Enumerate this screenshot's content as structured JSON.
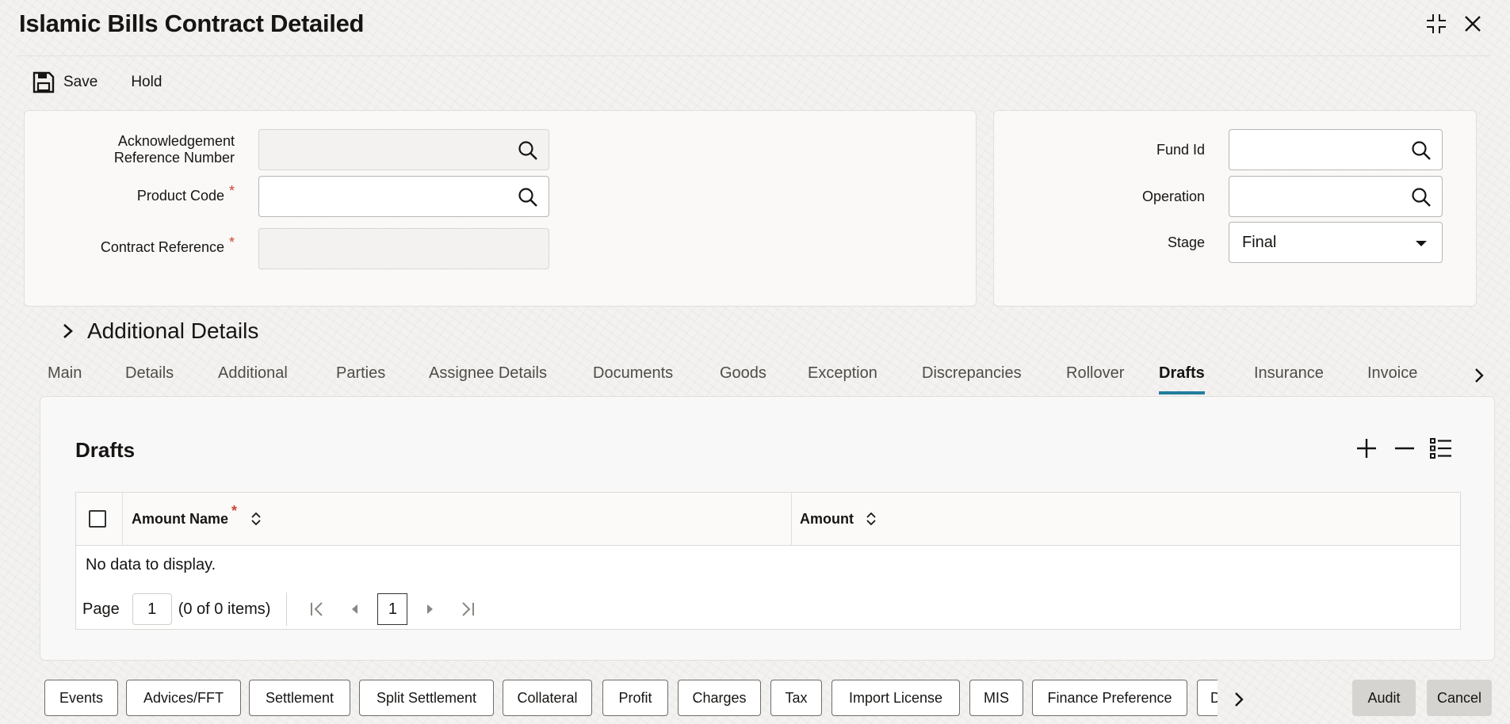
{
  "window": {
    "title": "Islamic Bills Contract Detailed"
  },
  "toolbar": {
    "save_label": "Save",
    "hold_label": "Hold"
  },
  "form": {
    "ack_ref_label": "Acknowledgement Reference Number",
    "ack_ref_value": "",
    "product_code_label": "Product Code",
    "product_code_value": "",
    "contract_ref_label": "Contract Reference",
    "contract_ref_value": "",
    "required_mark": "*",
    "fund_id_label": "Fund Id",
    "fund_id_value": "",
    "operation_label": "Operation",
    "operation_value": "",
    "stage_label": "Stage",
    "stage_value": "Final"
  },
  "additional_details": {
    "label": "Additional Details"
  },
  "tabs": [
    {
      "label": "Main"
    },
    {
      "label": "Details"
    },
    {
      "label": "Additional"
    },
    {
      "label": "Parties"
    },
    {
      "label": "Assignee Details"
    },
    {
      "label": "Documents"
    },
    {
      "label": "Goods"
    },
    {
      "label": "Exception"
    },
    {
      "label": "Discrepancies"
    },
    {
      "label": "Rollover"
    },
    {
      "label": "Drafts"
    },
    {
      "label": "Insurance"
    },
    {
      "label": "Invoice"
    }
  ],
  "active_tab": "Drafts",
  "drafts": {
    "title": "Drafts",
    "columns": [
      {
        "label": "Amount Name"
      },
      {
        "label": "Amount"
      }
    ],
    "empty_text": "No data to display.",
    "pager": {
      "page_label": "Page",
      "page_value": "1",
      "items_text": "(0 of 0 items)",
      "current_page": "1"
    }
  },
  "bottom_buttons": [
    {
      "label": "Events"
    },
    {
      "label": "Advices/FFT"
    },
    {
      "label": "Settlement"
    },
    {
      "label": "Split Settlement"
    },
    {
      "label": "Collateral"
    },
    {
      "label": "Profit"
    },
    {
      "label": "Charges"
    },
    {
      "label": "Tax"
    },
    {
      "label": "Import License"
    },
    {
      "label": "MIS"
    },
    {
      "label": "Finance Preference"
    },
    {
      "label": "D"
    }
  ],
  "footer": {
    "audit_label": "Audit",
    "cancel_label": "Cancel"
  },
  "colors": {
    "accent": "#227e9e",
    "required": "#c74634",
    "background": "#f3f2f0"
  }
}
